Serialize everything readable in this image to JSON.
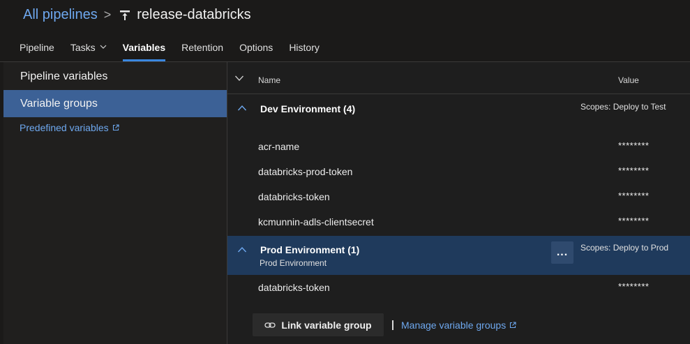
{
  "breadcrumb": {
    "parent": "All pipelines",
    "separator": ">",
    "title": "release-databricks",
    "title_icon": "release-pipeline-icon"
  },
  "tabs": [
    {
      "label": "Pipeline",
      "active": false
    },
    {
      "label": "Tasks",
      "active": false,
      "has_dropdown": true
    },
    {
      "label": "Variables",
      "active": true
    },
    {
      "label": "Retention",
      "active": false
    },
    {
      "label": "Options",
      "active": false
    },
    {
      "label": "History",
      "active": false
    }
  ],
  "sidebar": {
    "items": [
      {
        "label": "Pipeline variables",
        "selected": false
      },
      {
        "label": "Variable groups",
        "selected": true
      }
    ],
    "predefined_link": "Predefined variables"
  },
  "table": {
    "col_name": "Name",
    "col_value": "Value"
  },
  "groups": [
    {
      "title": "Dev Environment (4)",
      "subtitle": "",
      "scope": "Scopes: Deploy to Test",
      "variables": [
        {
          "name": "acr-name",
          "value": "********"
        },
        {
          "name": "databricks-prod-token",
          "value": "********"
        },
        {
          "name": "databricks-token",
          "value": "********"
        },
        {
          "name": "kcmunnin-adls-clientsecret",
          "value": "********"
        }
      ]
    },
    {
      "title": "Prod Environment (1)",
      "subtitle": "Prod Environment",
      "scope": "Scopes: Deploy to Prod",
      "more_label": "...",
      "variables": [
        {
          "name": "databricks-token",
          "value": "********"
        }
      ]
    }
  ],
  "actions": {
    "link_group": "Link variable group",
    "manage_groups": "Manage variable groups"
  },
  "colors": {
    "accent": "#3a87e0",
    "link": "#6ea8ef",
    "selected": "#3c6196",
    "highlight": "#1f3a5c"
  }
}
